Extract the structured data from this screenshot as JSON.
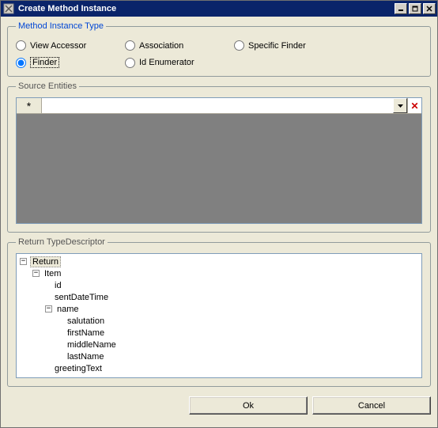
{
  "window": {
    "title": "Create Method Instance"
  },
  "methodType": {
    "legend": "Method Instance Type",
    "options": {
      "viewAccessor": "View Accessor",
      "association": "Association",
      "specificFinder": "Specific Finder",
      "finder": "Finder",
      "idEnumerator": "Id Enumerator"
    },
    "selected": "finder"
  },
  "sourceEntities": {
    "legend": "Source Entities",
    "rowMarker": "*",
    "value": ""
  },
  "returnType": {
    "legend": "Return TypeDescriptor",
    "tree": {
      "root": "Return",
      "item": "Item",
      "id": "id",
      "sentDateTime": "sentDateTime",
      "name": "name",
      "salutation": "salutation",
      "firstName": "firstName",
      "middleName": "middleName",
      "lastName": "lastName",
      "greetingText": "greetingText"
    }
  },
  "buttons": {
    "ok": "Ok",
    "cancel": "Cancel"
  }
}
